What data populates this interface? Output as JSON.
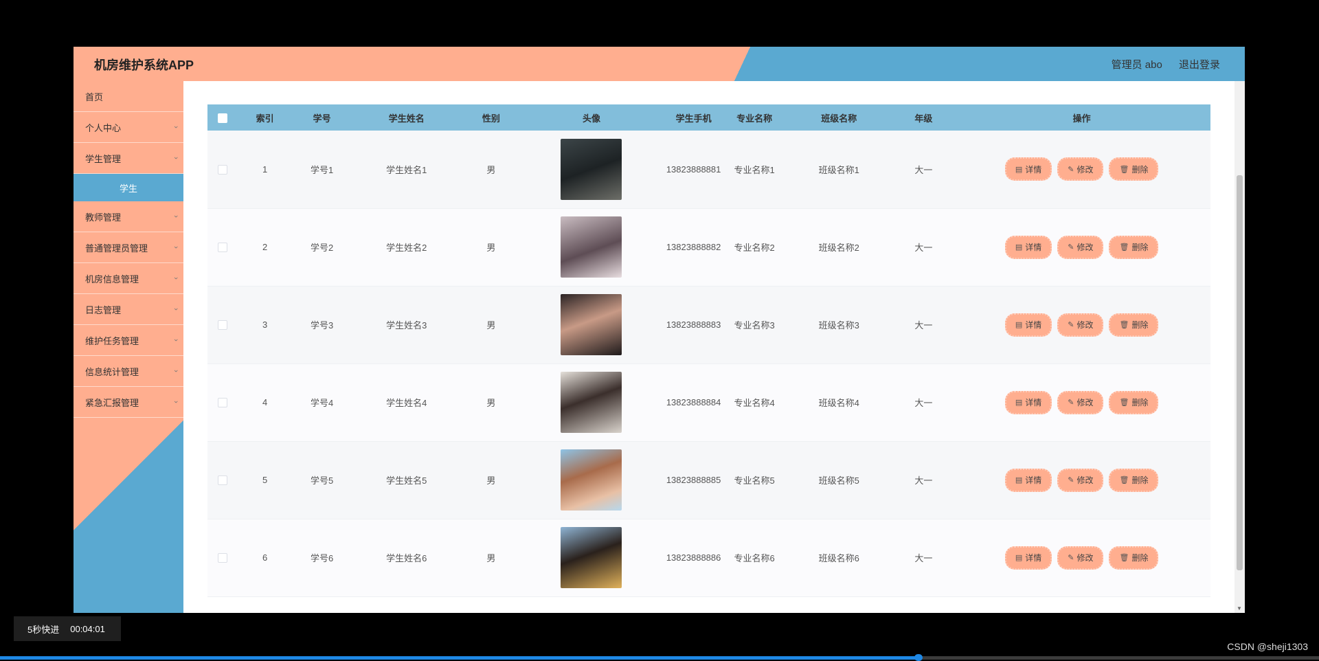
{
  "header": {
    "app_title": "机房维护系统APP",
    "admin_label": "管理员 abo",
    "logout_label": "退出登录"
  },
  "sidebar": {
    "items": [
      {
        "label": "首页",
        "has_arrow": false
      },
      {
        "label": "个人中心",
        "has_arrow": true
      },
      {
        "label": "学生管理",
        "has_arrow": true,
        "expanded": true,
        "sub_items": [
          "学生"
        ]
      },
      {
        "label": "教师管理",
        "has_arrow": true
      },
      {
        "label": "普通管理员管理",
        "has_arrow": true
      },
      {
        "label": "机房信息管理",
        "has_arrow": true
      },
      {
        "label": "日志管理",
        "has_arrow": true
      },
      {
        "label": "维护任务管理",
        "has_arrow": true
      },
      {
        "label": "信息统计管理",
        "has_arrow": true
      },
      {
        "label": "紧急汇报管理",
        "has_arrow": true
      }
    ]
  },
  "table": {
    "columns": [
      "索引",
      "学号",
      "学生姓名",
      "性别",
      "头像",
      "学生手机",
      "专业名称",
      "班级名称",
      "年级",
      "操作"
    ],
    "rows": [
      {
        "index": "1",
        "student_no": "学号1",
        "name": "学生姓名1",
        "gender": "男",
        "phone": "13823888881",
        "major": "专业名称1",
        "class": "班级名称1",
        "grade": "大一"
      },
      {
        "index": "2",
        "student_no": "学号2",
        "name": "学生姓名2",
        "gender": "男",
        "phone": "13823888882",
        "major": "专业名称2",
        "class": "班级名称2",
        "grade": "大一"
      },
      {
        "index": "3",
        "student_no": "学号3",
        "name": "学生姓名3",
        "gender": "男",
        "phone": "13823888883",
        "major": "专业名称3",
        "class": "班级名称3",
        "grade": "大一"
      },
      {
        "index": "4",
        "student_no": "学号4",
        "name": "学生姓名4",
        "gender": "男",
        "phone": "13823888884",
        "major": "专业名称4",
        "class": "班级名称4",
        "grade": "大一"
      },
      {
        "index": "5",
        "student_no": "学号5",
        "name": "学生姓名5",
        "gender": "男",
        "phone": "13823888885",
        "major": "专业名称5",
        "class": "班级名称5",
        "grade": "大一"
      },
      {
        "index": "6",
        "student_no": "学号6",
        "name": "学生姓名6",
        "gender": "男",
        "phone": "13823888886",
        "major": "专业名称6",
        "class": "班级名称6",
        "grade": "大一"
      }
    ],
    "actions": {
      "detail": "详情",
      "edit": "修改",
      "delete": "删除"
    }
  },
  "player": {
    "skip_label": "5秒快进",
    "time": "00:04:01",
    "progress": 0.697
  },
  "watermark": "CSDN @sheji1303",
  "colors": {
    "salmon": "#ffae8f",
    "blue": "#5aa9d1",
    "table_header": "#82bedb"
  }
}
